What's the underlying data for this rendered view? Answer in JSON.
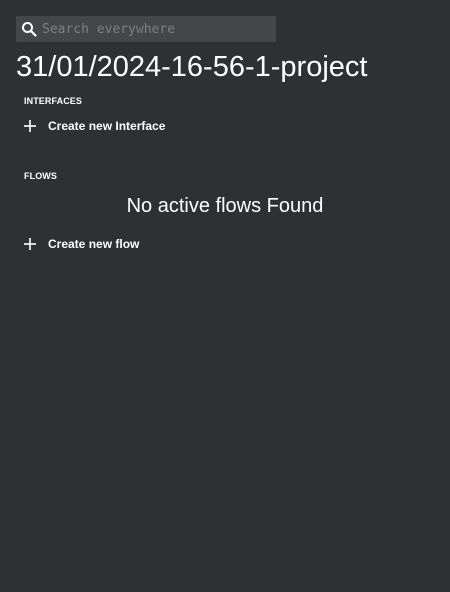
{
  "search": {
    "placeholder": "Search everywhere",
    "value": ""
  },
  "project": {
    "title": "31/01/2024-16-56-1-project"
  },
  "interfaces": {
    "section_label": "INTERFACES",
    "create_label": "Create new Interface"
  },
  "flows": {
    "section_label": "FLOWS",
    "empty_message": "No active flows Found",
    "create_label": "Create new flow"
  },
  "icons": {
    "search": "search-icon",
    "add": "plus-icon"
  },
  "colors": {
    "background": "#2f3033",
    "search_background": "#45464a",
    "text": "#ffffff",
    "placeholder": "#7d7e82"
  }
}
